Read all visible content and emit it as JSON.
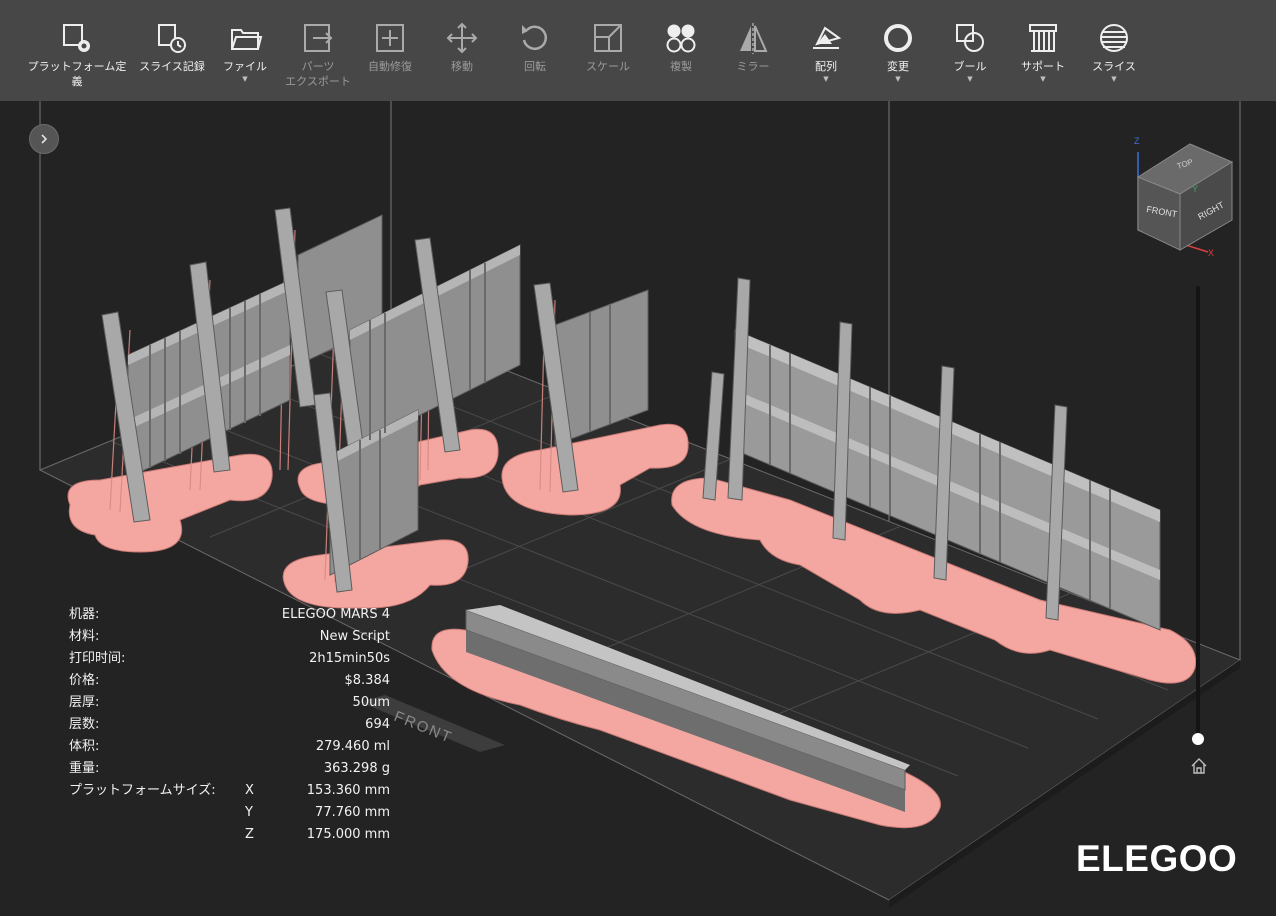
{
  "toolbar": {
    "items": [
      {
        "label": "プラットフォーム定義",
        "icon": "platform-settings-icon",
        "enabled": true,
        "dropdown": false
      },
      {
        "label": "スライス記録",
        "icon": "slice-history-icon",
        "enabled": true,
        "dropdown": false
      },
      {
        "label": "ファイル",
        "icon": "folder-icon",
        "enabled": true,
        "dropdown": true
      },
      {
        "label": "パーツ\nエクスポート",
        "icon": "export-icon",
        "enabled": false,
        "dropdown": false
      },
      {
        "label": "自動修復",
        "icon": "auto-repair-icon",
        "enabled": false,
        "dropdown": false
      },
      {
        "label": "移動",
        "icon": "move-icon",
        "enabled": false,
        "dropdown": false
      },
      {
        "label": "回転",
        "icon": "rotate-icon",
        "enabled": false,
        "dropdown": false
      },
      {
        "label": "スケール",
        "icon": "scale-icon",
        "enabled": false,
        "dropdown": false
      },
      {
        "label": "複製",
        "icon": "duplicate-icon",
        "enabled": false,
        "dropdown": false
      },
      {
        "label": "ミラー",
        "icon": "mirror-icon",
        "enabled": false,
        "dropdown": false
      },
      {
        "label": "配列",
        "icon": "arrange-icon",
        "enabled": true,
        "dropdown": true
      },
      {
        "label": "変更",
        "icon": "hollow-icon",
        "enabled": true,
        "dropdown": true
      },
      {
        "label": "ブール",
        "icon": "boolean-icon",
        "enabled": true,
        "dropdown": true
      },
      {
        "label": "サポート",
        "icon": "support-icon",
        "enabled": true,
        "dropdown": true
      },
      {
        "label": "スライス",
        "icon": "slice-icon",
        "enabled": true,
        "dropdown": true
      }
    ]
  },
  "info": {
    "machine": {
      "label": "机器:",
      "value": "ELEGOO MARS 4"
    },
    "material": {
      "label": "材料:",
      "value": "New Script"
    },
    "print_time": {
      "label": "打印时间:",
      "value": "2h15min50s"
    },
    "price": {
      "label": "价格:",
      "value": "$8.384"
    },
    "layer_height": {
      "label": "层厚:",
      "value": "50um"
    },
    "layer_count": {
      "label": "层数:",
      "value": "694"
    },
    "volume": {
      "label": "体积:",
      "value": "279.460 ml"
    },
    "weight": {
      "label": "重量:",
      "value": "363.298 g"
    },
    "platform_size": {
      "label": "プラットフォームサイズ:",
      "x_axis": "X",
      "x_value": "153.360 mm",
      "y_axis": "Y",
      "y_value": "77.760 mm",
      "z_axis": "Z",
      "z_value": "175.000 mm"
    }
  },
  "viewport": {
    "front_label": "FRONT",
    "viewcube": {
      "top": "TOP",
      "front": "FRONT",
      "right": "RIGHT",
      "axis_x": "X",
      "axis_y": "Y",
      "axis_z": "Z"
    },
    "layer_slider_level": 1.0
  },
  "brand": {
    "logo_text": "ELEGOO"
  },
  "colors": {
    "toolbar_bg": "#474747",
    "viewport_bg": "#232323",
    "plate": "#2c2c2c",
    "raft": "#f4a6a0",
    "support": "#d98a84",
    "model": "#9a9a9a",
    "model_dark": "#6e6e6e"
  }
}
